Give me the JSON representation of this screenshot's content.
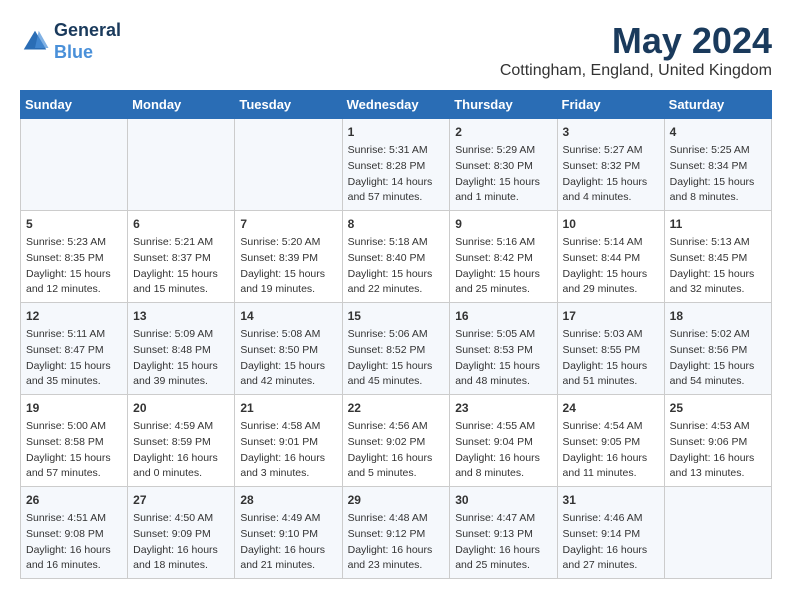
{
  "header": {
    "logo_line1": "General",
    "logo_line2": "Blue",
    "month": "May 2024",
    "location": "Cottingham, England, United Kingdom"
  },
  "weekdays": [
    "Sunday",
    "Monday",
    "Tuesday",
    "Wednesday",
    "Thursday",
    "Friday",
    "Saturday"
  ],
  "weeks": [
    [
      {
        "day": "",
        "info": ""
      },
      {
        "day": "",
        "info": ""
      },
      {
        "day": "",
        "info": ""
      },
      {
        "day": "1",
        "info": "Sunrise: 5:31 AM\nSunset: 8:28 PM\nDaylight: 14 hours\nand 57 minutes."
      },
      {
        "day": "2",
        "info": "Sunrise: 5:29 AM\nSunset: 8:30 PM\nDaylight: 15 hours\nand 1 minute."
      },
      {
        "day": "3",
        "info": "Sunrise: 5:27 AM\nSunset: 8:32 PM\nDaylight: 15 hours\nand 4 minutes."
      },
      {
        "day": "4",
        "info": "Sunrise: 5:25 AM\nSunset: 8:34 PM\nDaylight: 15 hours\nand 8 minutes."
      }
    ],
    [
      {
        "day": "5",
        "info": "Sunrise: 5:23 AM\nSunset: 8:35 PM\nDaylight: 15 hours\nand 12 minutes."
      },
      {
        "day": "6",
        "info": "Sunrise: 5:21 AM\nSunset: 8:37 PM\nDaylight: 15 hours\nand 15 minutes."
      },
      {
        "day": "7",
        "info": "Sunrise: 5:20 AM\nSunset: 8:39 PM\nDaylight: 15 hours\nand 19 minutes."
      },
      {
        "day": "8",
        "info": "Sunrise: 5:18 AM\nSunset: 8:40 PM\nDaylight: 15 hours\nand 22 minutes."
      },
      {
        "day": "9",
        "info": "Sunrise: 5:16 AM\nSunset: 8:42 PM\nDaylight: 15 hours\nand 25 minutes."
      },
      {
        "day": "10",
        "info": "Sunrise: 5:14 AM\nSunset: 8:44 PM\nDaylight: 15 hours\nand 29 minutes."
      },
      {
        "day": "11",
        "info": "Sunrise: 5:13 AM\nSunset: 8:45 PM\nDaylight: 15 hours\nand 32 minutes."
      }
    ],
    [
      {
        "day": "12",
        "info": "Sunrise: 5:11 AM\nSunset: 8:47 PM\nDaylight: 15 hours\nand 35 minutes."
      },
      {
        "day": "13",
        "info": "Sunrise: 5:09 AM\nSunset: 8:48 PM\nDaylight: 15 hours\nand 39 minutes."
      },
      {
        "day": "14",
        "info": "Sunrise: 5:08 AM\nSunset: 8:50 PM\nDaylight: 15 hours\nand 42 minutes."
      },
      {
        "day": "15",
        "info": "Sunrise: 5:06 AM\nSunset: 8:52 PM\nDaylight: 15 hours\nand 45 minutes."
      },
      {
        "day": "16",
        "info": "Sunrise: 5:05 AM\nSunset: 8:53 PM\nDaylight: 15 hours\nand 48 minutes."
      },
      {
        "day": "17",
        "info": "Sunrise: 5:03 AM\nSunset: 8:55 PM\nDaylight: 15 hours\nand 51 minutes."
      },
      {
        "day": "18",
        "info": "Sunrise: 5:02 AM\nSunset: 8:56 PM\nDaylight: 15 hours\nand 54 minutes."
      }
    ],
    [
      {
        "day": "19",
        "info": "Sunrise: 5:00 AM\nSunset: 8:58 PM\nDaylight: 15 hours\nand 57 minutes."
      },
      {
        "day": "20",
        "info": "Sunrise: 4:59 AM\nSunset: 8:59 PM\nDaylight: 16 hours\nand 0 minutes."
      },
      {
        "day": "21",
        "info": "Sunrise: 4:58 AM\nSunset: 9:01 PM\nDaylight: 16 hours\nand 3 minutes."
      },
      {
        "day": "22",
        "info": "Sunrise: 4:56 AM\nSunset: 9:02 PM\nDaylight: 16 hours\nand 5 minutes."
      },
      {
        "day": "23",
        "info": "Sunrise: 4:55 AM\nSunset: 9:04 PM\nDaylight: 16 hours\nand 8 minutes."
      },
      {
        "day": "24",
        "info": "Sunrise: 4:54 AM\nSunset: 9:05 PM\nDaylight: 16 hours\nand 11 minutes."
      },
      {
        "day": "25",
        "info": "Sunrise: 4:53 AM\nSunset: 9:06 PM\nDaylight: 16 hours\nand 13 minutes."
      }
    ],
    [
      {
        "day": "26",
        "info": "Sunrise: 4:51 AM\nSunset: 9:08 PM\nDaylight: 16 hours\nand 16 minutes."
      },
      {
        "day": "27",
        "info": "Sunrise: 4:50 AM\nSunset: 9:09 PM\nDaylight: 16 hours\nand 18 minutes."
      },
      {
        "day": "28",
        "info": "Sunrise: 4:49 AM\nSunset: 9:10 PM\nDaylight: 16 hours\nand 21 minutes."
      },
      {
        "day": "29",
        "info": "Sunrise: 4:48 AM\nSunset: 9:12 PM\nDaylight: 16 hours\nand 23 minutes."
      },
      {
        "day": "30",
        "info": "Sunrise: 4:47 AM\nSunset: 9:13 PM\nDaylight: 16 hours\nand 25 minutes."
      },
      {
        "day": "31",
        "info": "Sunrise: 4:46 AM\nSunset: 9:14 PM\nDaylight: 16 hours\nand 27 minutes."
      },
      {
        "day": "",
        "info": ""
      }
    ]
  ]
}
